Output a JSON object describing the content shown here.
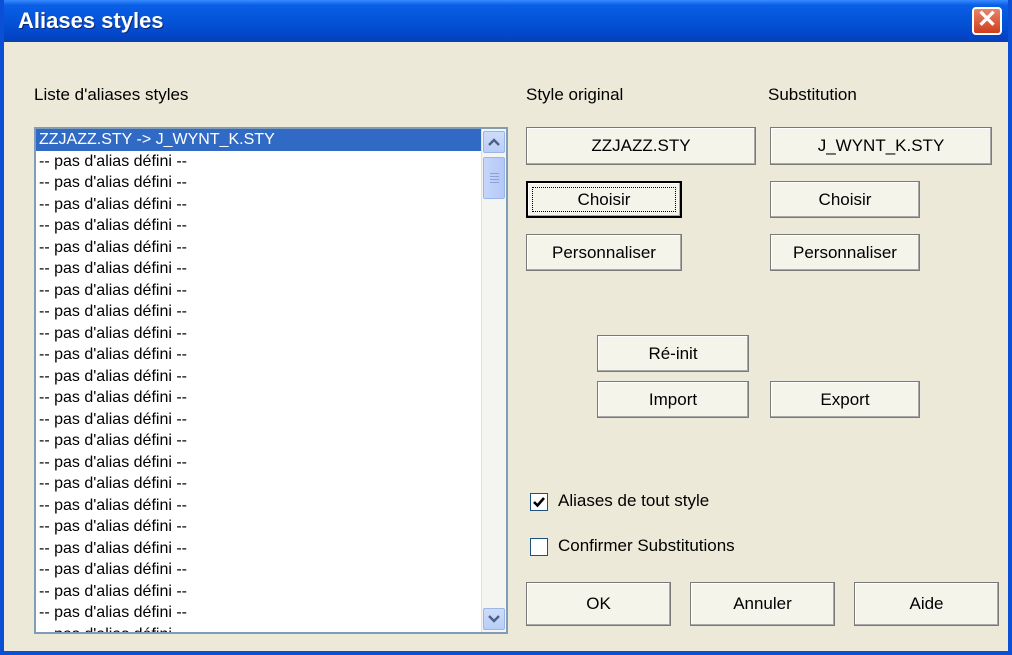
{
  "window": {
    "title": "Aliases styles",
    "close_label": "✕"
  },
  "labels": {
    "list_heading": "Liste d'aliases styles",
    "list_heading_underline": "L",
    "style_original": "Style original",
    "substitution": "Substitution"
  },
  "list": {
    "items": [
      "ZZJAZZ.STY -> J_WYNT_K.STY",
      "-- pas d'alias défini --",
      "-- pas d'alias défini --",
      "-- pas d'alias défini --",
      "-- pas d'alias défini --",
      "-- pas d'alias défini --",
      "-- pas d'alias défini --",
      "-- pas d'alias défini --",
      "-- pas d'alias défini --",
      "-- pas d'alias défini --",
      "-- pas d'alias défini --",
      "-- pas d'alias défini --",
      "-- pas d'alias défini --",
      "-- pas d'alias défini --",
      "-- pas d'alias défini --",
      "-- pas d'alias défini --",
      "-- pas d'alias défini --",
      "-- pas d'alias défini --",
      "-- pas d'alias défini --",
      "-- pas d'alias défini --",
      "-- pas d'alias défini --",
      "-- pas d'alias défini --",
      "-- pas d'alias défini --",
      "-- pas d'alias défini --"
    ],
    "selected_index": 0
  },
  "original": {
    "style_name": "ZZJAZZ.STY",
    "choose_label": "Choisir",
    "customize_label": "Personnaliser"
  },
  "substitute": {
    "style_name": "J_WYNT_K.STY",
    "choose_label": "Choisir",
    "customize_label": "Personnaliser"
  },
  "actions": {
    "reinit_label": "Ré-init",
    "import_label": "Import",
    "export_label": "Export"
  },
  "options": {
    "all_styles_label": "Aliases de tout style",
    "all_styles_checked": true,
    "confirm_label": "Confirmer Substitutions",
    "confirm_checked": false
  },
  "footer": {
    "ok_label": "OK",
    "cancel_label": "Annuler",
    "help_label": "Aide"
  },
  "icons": {
    "scroll_up": "chevron-up-icon",
    "scroll_down": "chevron-down-icon",
    "checkmark": "checkmark-icon"
  }
}
